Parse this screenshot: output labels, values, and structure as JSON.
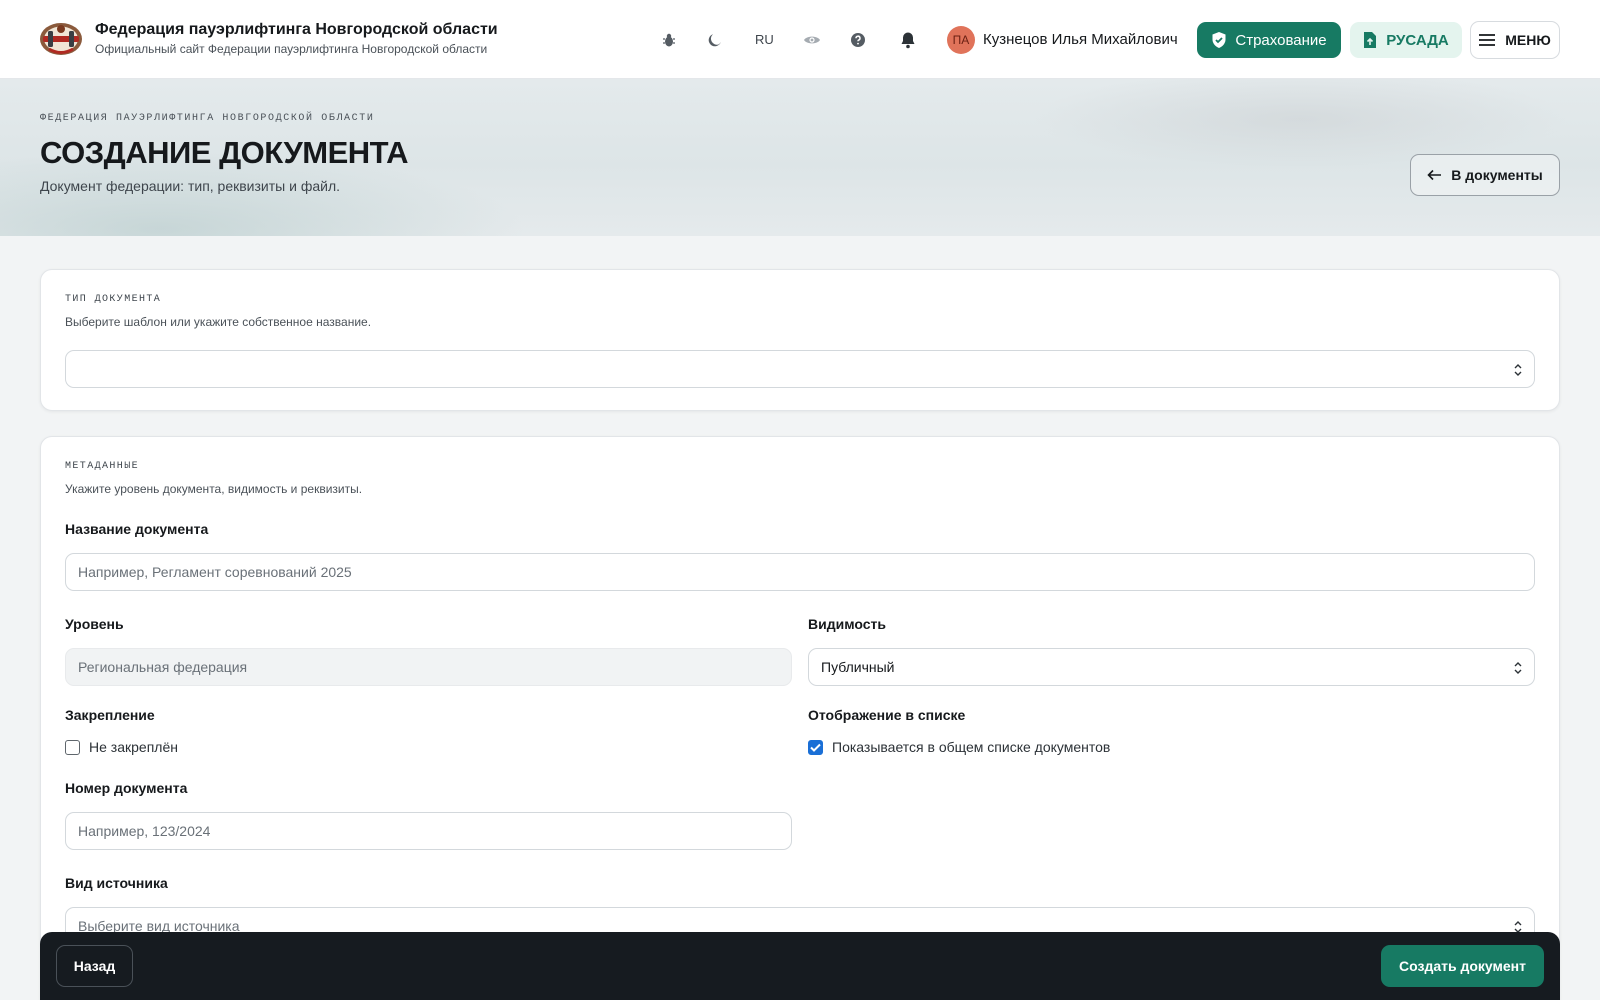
{
  "header": {
    "title": "Федерация пауэрлифтинга Новгородской области",
    "subtitle": "Официальный сайт Федерации пауэрлифтинга Новгородской области",
    "lang": "RU",
    "avatar_initials": "ПА",
    "user_name": "Кузнецов Илья Михайлович",
    "insurance_label": "Страхование",
    "rusada_label": "РУСАДА",
    "menu_label": "МЕНЮ",
    "accent_color": "#177a63"
  },
  "hero": {
    "eyebrow": "ФЕДЕРАЦИЯ ПАУЭРЛИФТИНГА НОВГОРОДСКОЙ ОБЛАСТИ",
    "title": "СОЗДАНИЕ ДОКУМЕНТА",
    "subtitle": "Документ федерации: тип, реквизиты и файл.",
    "back_button": "В документы"
  },
  "doc_type": {
    "label": "ТИП ДОКУМЕНТА",
    "help": "Выберите шаблон или укажите собственное название.",
    "value": ""
  },
  "metadata": {
    "label": "МЕТАДАННЫЕ",
    "help": "Укажите уровень документа, видимость и реквизиты.",
    "name_label": "Название документа",
    "name_placeholder": "Например, Регламент соревнований 2025",
    "level_label": "Уровень",
    "level_placeholder": "Региональная федерация",
    "visibility_label": "Видимость",
    "visibility_value": "Публичный",
    "pin_label": "Закрепление",
    "pin_checkbox": "Не закреплён",
    "pin_checked": false,
    "list_label": "Отображение в списке",
    "list_checkbox": "Показывается в общем списке документов",
    "list_checked": true,
    "number_label": "Номер документа",
    "number_placeholder": "Например, 123/2024",
    "source_label": "Вид источника",
    "source_placeholder": "Выберите вид источника"
  },
  "footer": {
    "back_label": "Назад",
    "create_label": "Создать документ"
  }
}
